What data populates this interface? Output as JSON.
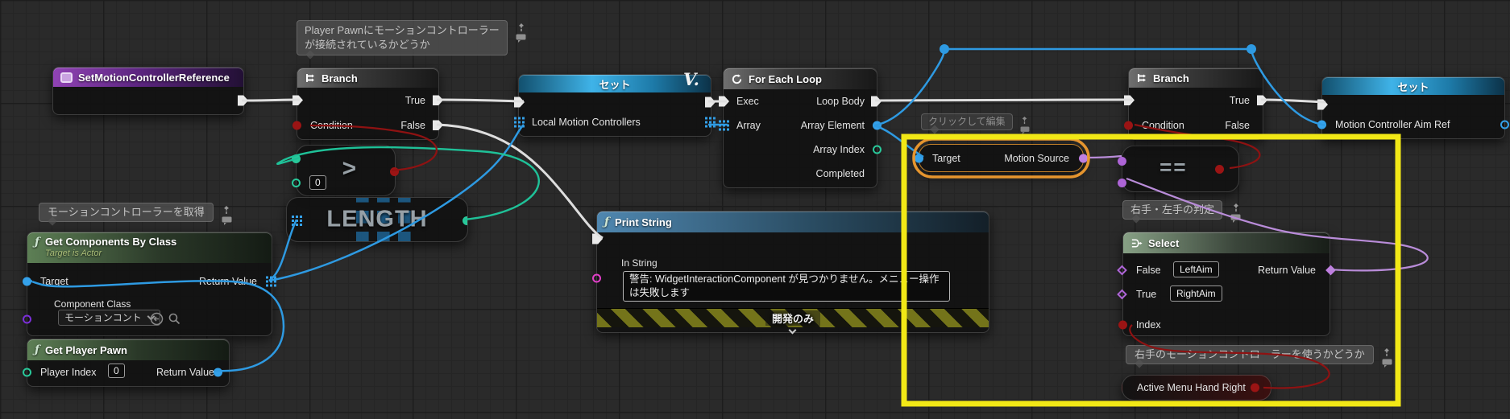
{
  "watermark": "V.",
  "comments": {
    "player_pawn": "Player Pawnにモーションコントローラーが接続されているかどうか",
    "click_to_edit": "クリックして編集",
    "hand_judge": "右手・左手の判定",
    "use_right_hand": "右手のモーションコントローラーを使うかどうか",
    "get_motion_controllers": "モーションコントローラーを取得"
  },
  "nodes": {
    "set_motion_controller_reference": {
      "title": "SetMotionControllerReference"
    },
    "branch1": {
      "title": "Branch",
      "true_label": "True",
      "false_label": "False",
      "condition_label": "Condition"
    },
    "branch2": {
      "title": "Branch",
      "true_label": "True",
      "false_label": "False",
      "condition_label": "Condition"
    },
    "set_local": {
      "title": "セット",
      "variable": "Local Motion Controllers"
    },
    "set_aim_ref": {
      "title": "セット",
      "variable": "Motion Controller Aim Ref"
    },
    "for_each_loop": {
      "title": "For Each Loop",
      "exec": "Exec",
      "array": "Array",
      "loop_body": "Loop Body",
      "array_element": "Array Element",
      "array_index": "Array Index",
      "completed": "Completed"
    },
    "get_motion_source": {
      "target_label": "Target",
      "output_label": "Motion Source"
    },
    "equals": {
      "symbol": "=="
    },
    "select": {
      "title": "Select",
      "false_label": "False",
      "false_value": "LeftAim",
      "true_label": "True",
      "true_value": "RightAim",
      "index_label": "Index",
      "return_label": "Return Value"
    },
    "active_menu_hand_right": {
      "title": "Active Menu Hand Right"
    },
    "print_string": {
      "title": "Print String",
      "in_string_label": "In String",
      "in_string_value": "警告: WidgetInteractionComponent が見つかりません。メニュー操作は失敗します",
      "dev_only": "開発のみ"
    },
    "get_components_by_class": {
      "title": "Get Components By Class",
      "subtitle": "Target is Actor",
      "target_label": "Target",
      "return_label": "Return Value",
      "component_class_label": "Component Class",
      "component_class_value": "モーションコント"
    },
    "get_player_pawn": {
      "title": "Get Player Pawn",
      "player_index_label": "Player Index",
      "player_index_value": "0",
      "return_label": "Return Value"
    },
    "length": {
      "title": "LENGTH"
    },
    "greater": {
      "symbol": ">",
      "default_value": "0"
    }
  },
  "colors": {
    "exec_wire": "#e9e9e9",
    "object_blue": "#34a1ea",
    "bool_red": "#9b1414",
    "int_teal": "#29c89a",
    "enum_purple": "#ad64d6",
    "string_pink": "#e23fc8",
    "class_violet": "#7b2fd8",
    "highlight_yellow": "#f2e816",
    "selection_orange": "#e6952e"
  }
}
